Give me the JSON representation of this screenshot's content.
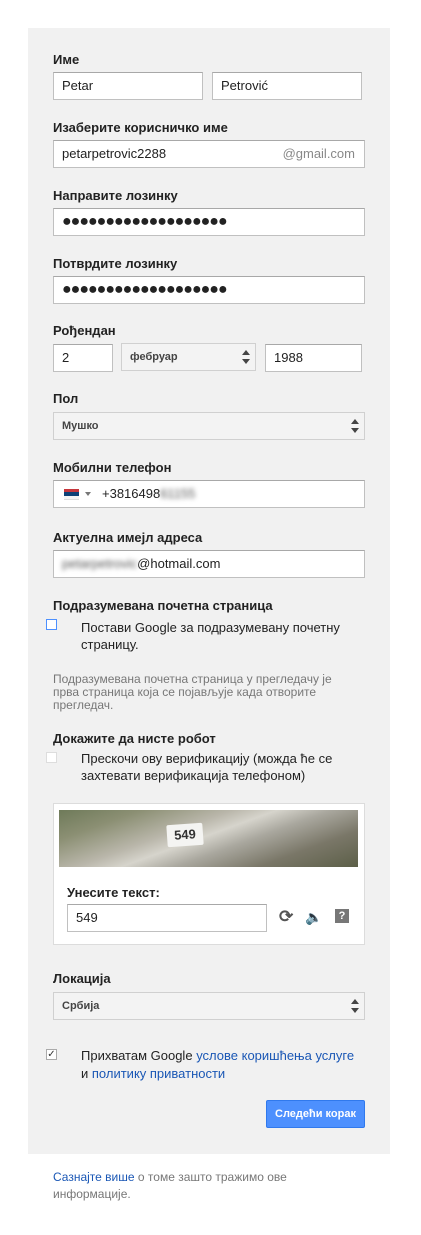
{
  "name": {
    "label": "Име",
    "first": "Petar",
    "last": "Petrović"
  },
  "username": {
    "label": "Изаберите корисничко име",
    "value": "petarpetrovic2288",
    "suffix": "@gmail.com"
  },
  "password": {
    "label": "Направите лозинку",
    "dots": "●●●●●●●●●●●●●●●●●●●"
  },
  "confirm": {
    "label": "Потврдите лозинку",
    "dots": "●●●●●●●●●●●●●●●●●●●"
  },
  "birthday": {
    "label": "Рођендан",
    "day": "2",
    "month": "фебруар",
    "year": "1988"
  },
  "gender": {
    "label": "Пол",
    "value": "Мушко"
  },
  "phone": {
    "label": "Мобилни телефон",
    "visible": "+3816498",
    "blurred": "61155",
    "flag_colors": [
      "#c6363c",
      "#0c4076",
      "#ffffff"
    ]
  },
  "email": {
    "label": "Актуелна имејл адреса",
    "blurred": "petarpetrovic",
    "domain": "@hotmail.com"
  },
  "homepage": {
    "heading": "Подразумевана почетна страница",
    "checkbox_line1": "Постави Google за подразумевану почетну",
    "checkbox_line2": "страницу.",
    "help_line1": "Подразумевана почетна страница у прегледачу је",
    "help_line2": "прва страница која се појављује када отворите",
    "help_line3": "прегледач."
  },
  "robot": {
    "heading": "Докажите да нисте робот",
    "skip_line1": "Прескочи ову верификацију (можда ће се",
    "skip_line2": "захтевати верификација телефоном)"
  },
  "captcha": {
    "image_text": "549",
    "prompt": "Унесите текст:",
    "value": "549",
    "icons": [
      "refresh-icon",
      "audio-icon",
      "help-icon"
    ]
  },
  "location": {
    "label": "Локација",
    "value": "Србија"
  },
  "terms": {
    "prefix": "Прихватам Google",
    "tos_link": "услове коришћења услуге",
    "and": "и",
    "privacy_link": "политику приватности",
    "checked_mark": "✓"
  },
  "next_button": "Следећи корак",
  "footer": {
    "link": "Сазнајте више",
    "text_line1": " о томе зашто тражимо ове",
    "text_line2": "информације."
  },
  "colors": {
    "accent": "#4d90fe",
    "link": "#1a57b5",
    "card": "#f1f1f1"
  }
}
